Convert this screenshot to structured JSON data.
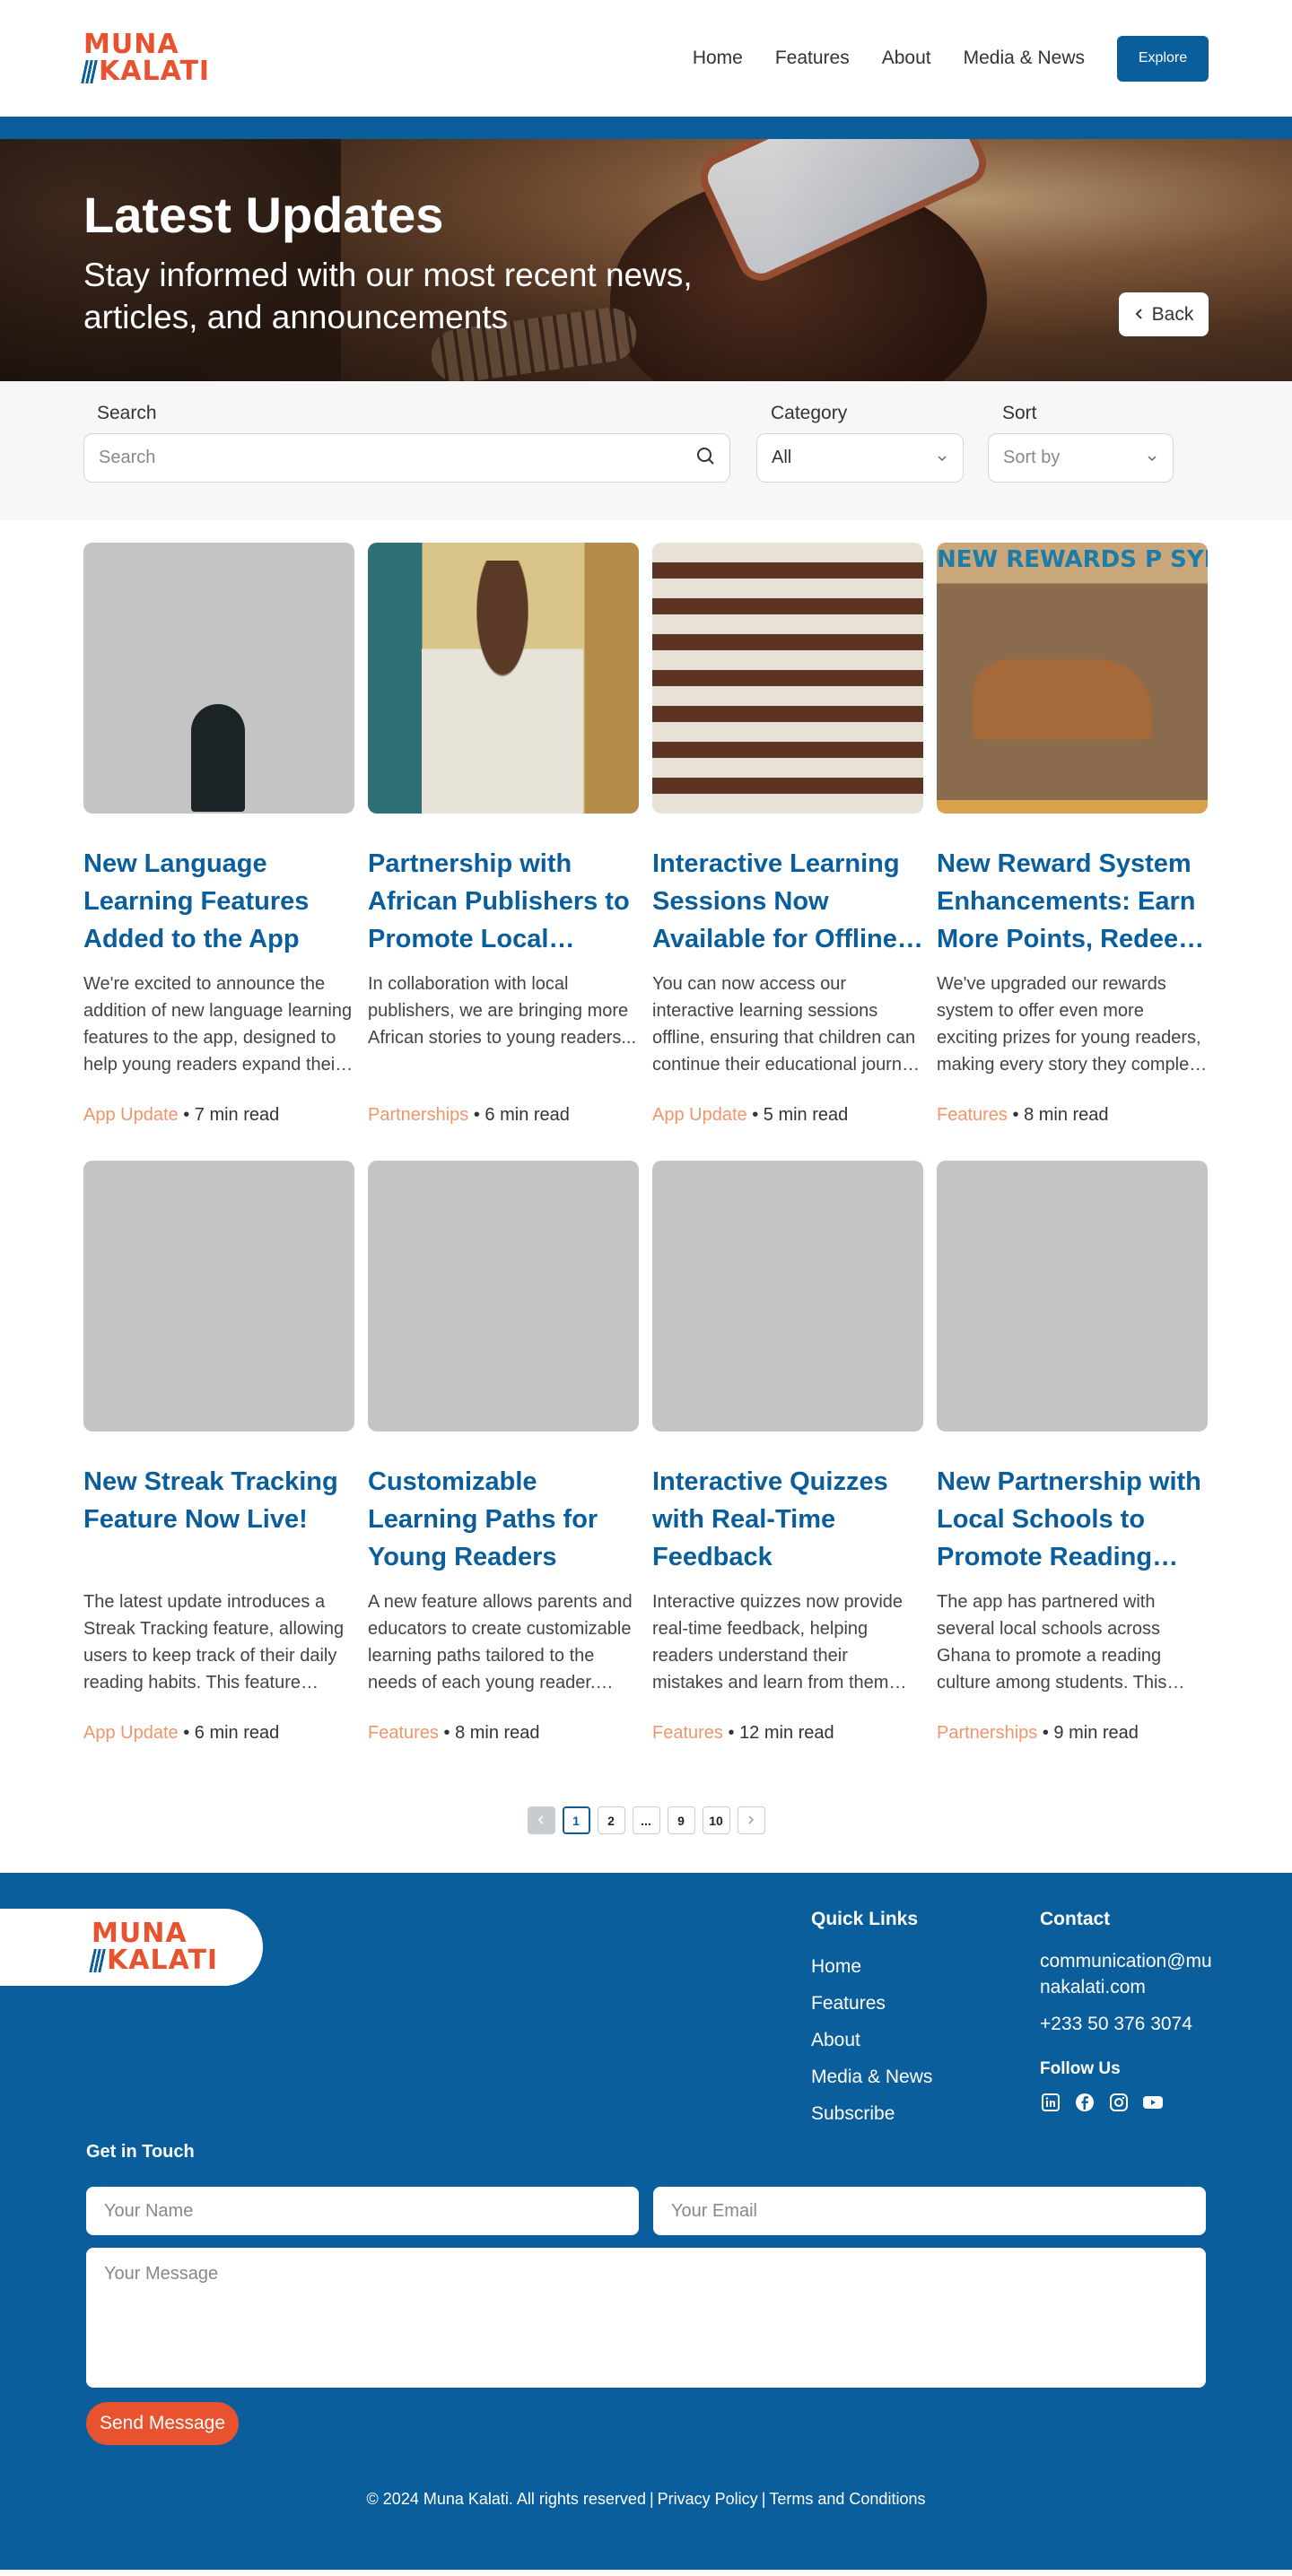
{
  "brand": {
    "logo_line1": "MUNA",
    "logo_line2": "KALATI",
    "accent": "#e8522e",
    "primary": "#0b5e9c"
  },
  "nav": {
    "items": [
      "Home",
      "Features",
      "About",
      "Media & News"
    ],
    "cta": "Explore"
  },
  "hero": {
    "title": "Latest Updates",
    "subtitle": "Stay informed with our most recent news, articles, and announcements",
    "back": "Back"
  },
  "filters": {
    "search_label": "Search",
    "search_placeholder": "Search",
    "category_label": "Category",
    "category_value": "All",
    "sort_label": "Sort",
    "sort_placeholder": "Sort by"
  },
  "cards": [
    {
      "title": "New Language Learning Features Added to the App",
      "desc": "We're excited to announce the addition of new language learning features to the app, designed to help young readers expand their linguistic skills.",
      "category": "App Update",
      "read": "7 min read"
    },
    {
      "title": "Partnership with African Publishers to Promote Local Literature",
      "desc": "In collaboration with local publishers, we are bringing more African stories to young readers...",
      "category": "Partnerships",
      "read": "6 min read"
    },
    {
      "title": "Interactive Learning Sessions Now Available for Offline Use",
      "desc": "You can now access our interactive learning sessions offline, ensuring that children can continue their educational journey without internet access.",
      "category": "App Update",
      "read": "5 min read"
    },
    {
      "title": "New Reward System Enhancements: Earn More Points, Redeem More Prizes",
      "desc": "We've upgraded our rewards system to offer even more exciting prizes for young readers, making every story they complete even more rewarding.",
      "category": "Features",
      "read": "8 min read"
    },
    {
      "title": "New Streak Tracking Feature Now Live!",
      "desc": "The latest update introduces a Streak Tracking feature, allowing users to keep track of their daily reading habits. This feature motivates users to read every day.",
      "category": "App Update",
      "read": "6 min read"
    },
    {
      "title": "Customizable Learning Paths for Young Readers",
      "desc": "A new feature allows parents and educators to create customizable learning paths tailored to the needs of each young reader. These paths guide children step by step.",
      "category": "Features",
      "read": "8 min read"
    },
    {
      "title": "Interactive Quizzes with Real-Time Feedback",
      "desc": "Interactive quizzes now provide real-time feedback, helping readers understand their mistakes and learn from them instantly. This feature is available for all stories.",
      "category": "Features",
      "read": "12 min read"
    },
    {
      "title": "New Partnership with Local Schools to Promote Reading Culture",
      "desc": "The app has partnered with several local schools across Ghana to promote a reading culture among students. This partnership includes providing free access.",
      "category": "Partnerships",
      "read": "9 min read"
    }
  ],
  "image_text": {
    "card4_banner": "NEW REWARDS P SYRAARITS"
  },
  "pagination": {
    "pages": [
      "1",
      "2",
      "...",
      "9",
      "10"
    ],
    "current": "1"
  },
  "footer": {
    "quick_links_title": "Quick Links",
    "quick_links": [
      "Home",
      "Features",
      "About",
      "Media & News",
      "Subscribe"
    ],
    "contact_title": "Contact",
    "email": "communication@munakalati.com",
    "phone": "+233 50 376 3074",
    "follow_title": "Follow Us",
    "socials": [
      "linkedin-icon",
      "facebook-icon",
      "instagram-icon",
      "youtube-icon"
    ],
    "get_in_touch": "Get in Touch",
    "name_placeholder": "Your Name",
    "email_placeholder": "Your Email",
    "message_placeholder": "Your Message",
    "send": "Send Message",
    "copyright": "© 2024 Muna Kalati. All rights reserved",
    "privacy": "Privacy Policy",
    "terms": "Terms and Conditions"
  }
}
